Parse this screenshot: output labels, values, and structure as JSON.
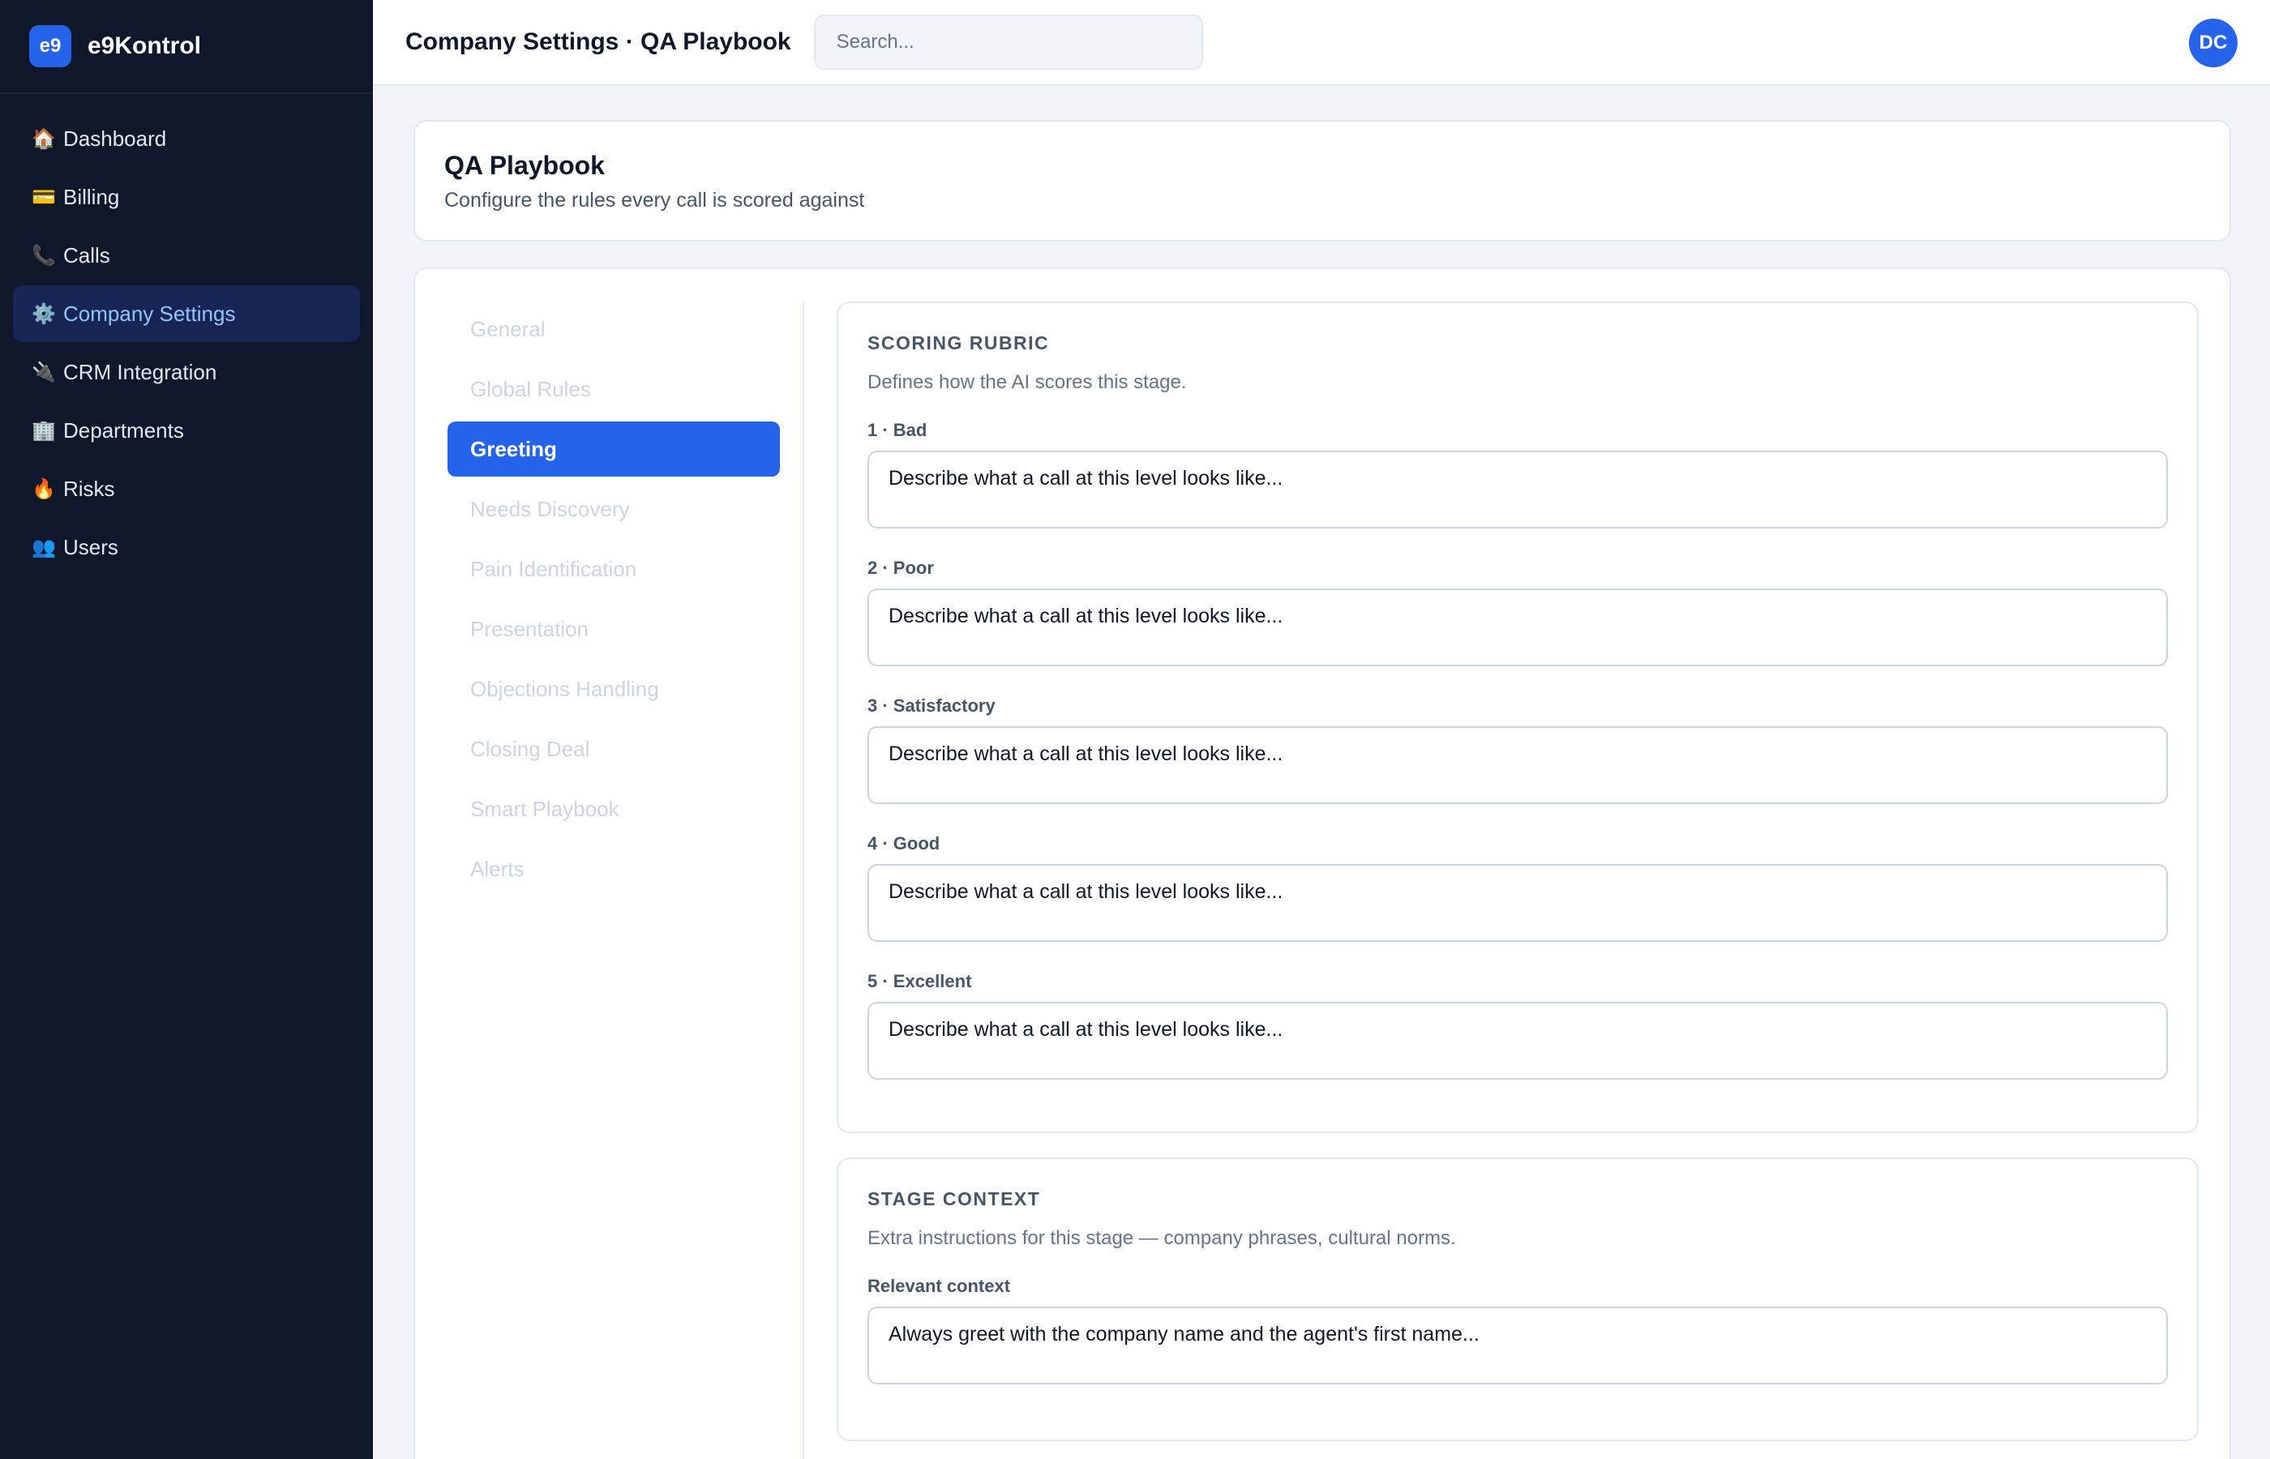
{
  "brand": {
    "logo_text": "e9",
    "name": "e9Kontrol"
  },
  "sidebar": {
    "items": [
      {
        "icon": "🏠",
        "icon_name": "home-icon",
        "label": "Dashboard",
        "active": false
      },
      {
        "icon": "💳",
        "icon_name": "credit-card-icon",
        "label": "Billing",
        "active": false
      },
      {
        "icon": "📞",
        "icon_name": "phone-icon",
        "label": "Calls",
        "active": false
      },
      {
        "icon": "⚙️",
        "icon_name": "gear-icon",
        "label": "Company Settings",
        "active": true
      },
      {
        "icon": "🔌",
        "icon_name": "plug-icon",
        "label": "CRM Integration",
        "active": false
      },
      {
        "icon": "🏢",
        "icon_name": "building-icon",
        "label": "Departments",
        "active": false
      },
      {
        "icon": "🔥",
        "icon_name": "fire-icon",
        "label": "Risks",
        "active": false
      },
      {
        "icon": "👥",
        "icon_name": "users-icon",
        "label": "Users",
        "active": false
      }
    ]
  },
  "topbar": {
    "breadcrumb": "Company Settings · QA Playbook",
    "search_placeholder": "Search...",
    "avatar_initials": "DC"
  },
  "header": {
    "title": "QA Playbook",
    "subtitle": "Configure the rules every call is scored against"
  },
  "stages": [
    {
      "label": "General",
      "active": false
    },
    {
      "label": "Global Rules",
      "active": false
    },
    {
      "label": "Greeting",
      "active": true
    },
    {
      "label": "Needs Discovery",
      "active": false
    },
    {
      "label": "Pain Identification",
      "active": false
    },
    {
      "label": "Presentation",
      "active": false
    },
    {
      "label": "Objections Handling",
      "active": false
    },
    {
      "label": "Closing Deal",
      "active": false
    },
    {
      "label": "Smart Playbook",
      "active": false
    },
    {
      "label": "Alerts",
      "active": false
    }
  ],
  "rubric": {
    "title": "SCORING RUBRIC",
    "description": "Defines how the AI scores this stage.",
    "levels": [
      {
        "label": "1 · Bad",
        "placeholder": "Describe what a call at this level looks like..."
      },
      {
        "label": "2 · Poor",
        "placeholder": "Describe what a call at this level looks like..."
      },
      {
        "label": "3 · Satisfactory",
        "placeholder": "Describe what a call at this level looks like..."
      },
      {
        "label": "4 · Good",
        "placeholder": "Describe what a call at this level looks like..."
      },
      {
        "label": "5 · Excellent",
        "placeholder": "Describe what a call at this level looks like..."
      }
    ]
  },
  "context": {
    "title": "STAGE CONTEXT",
    "description": "Extra instructions for this stage — company phrases, cultural norms.",
    "field_label": "Relevant context",
    "placeholder": "Always greet with the company name and the agent's first name..."
  },
  "colors": {
    "sidebar_bg": "#0f172a",
    "accent": "#2563eb",
    "active_nav_bg": "#172554",
    "active_nav_text": "#93c5fd",
    "page_bg": "#f1f5f9"
  }
}
